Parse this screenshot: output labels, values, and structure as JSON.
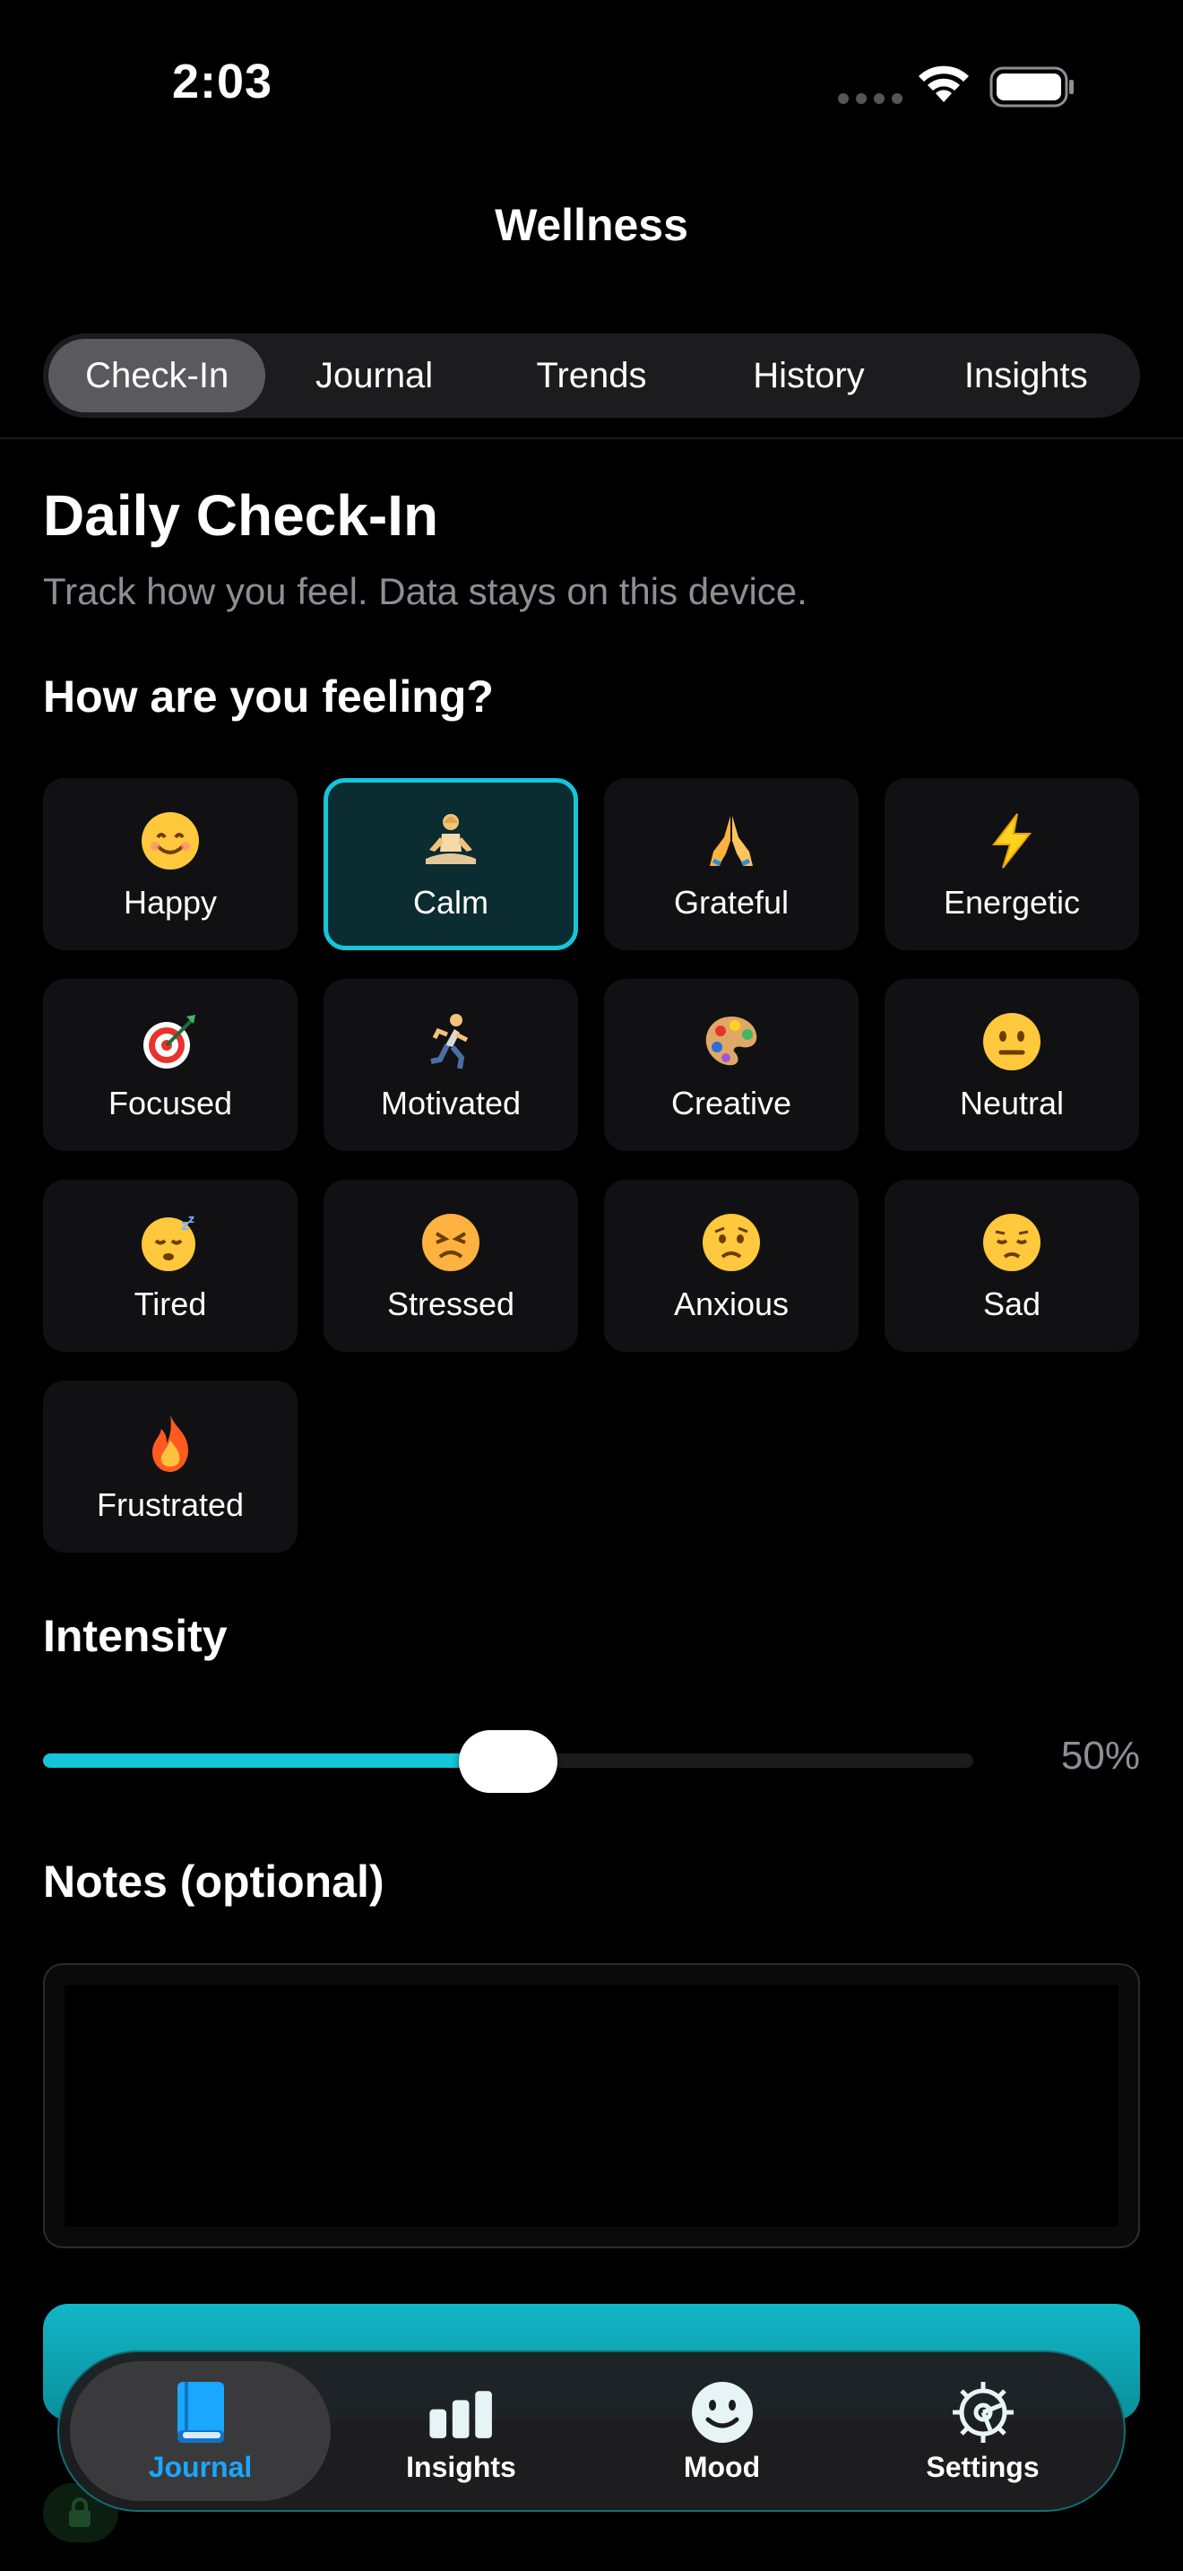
{
  "status": {
    "time": "2:03"
  },
  "nav": {
    "title": "Wellness"
  },
  "segments": [
    {
      "label": "Check-In",
      "active": true
    },
    {
      "label": "Journal",
      "active": false
    },
    {
      "label": "Trends",
      "active": false
    },
    {
      "label": "History",
      "active": false
    },
    {
      "label": "Insights",
      "active": false
    }
  ],
  "checkin": {
    "title": "Daily Check-In",
    "subtitle": "Track how you feel. Data stays on this device.",
    "feeling_heading": "How are you feeling?",
    "moods": [
      {
        "label": "Happy",
        "icon": "smiling-face-icon"
      },
      {
        "label": "Calm",
        "icon": "meditation-icon",
        "selected": true
      },
      {
        "label": "Grateful",
        "icon": "folded-hands-icon"
      },
      {
        "label": "Energetic",
        "icon": "lightning-icon"
      },
      {
        "label": "Focused",
        "icon": "target-icon"
      },
      {
        "label": "Motivated",
        "icon": "runner-icon"
      },
      {
        "label": "Creative",
        "icon": "palette-icon"
      },
      {
        "label": "Neutral",
        "icon": "neutral-face-icon"
      },
      {
        "label": "Tired",
        "icon": "sleepy-face-icon"
      },
      {
        "label": "Stressed",
        "icon": "stressed-face-icon"
      },
      {
        "label": "Anxious",
        "icon": "worried-face-icon"
      },
      {
        "label": "Sad",
        "icon": "sad-face-icon"
      },
      {
        "label": "Frustrated",
        "icon": "fire-icon"
      }
    ],
    "intensity_heading": "Intensity",
    "intensity_value": 0.5,
    "intensity_label": "50%",
    "notes_heading": "Notes (optional)",
    "notes_value": ""
  },
  "colors": {
    "accent": "#14c6d9",
    "tab_active": "#1aa7ff",
    "background": "#000000"
  },
  "tabbar": {
    "items": [
      {
        "label": "Journal",
        "icon": "book-icon",
        "active": true
      },
      {
        "label": "Insights",
        "icon": "bar-chart-icon",
        "active": false
      },
      {
        "label": "Mood",
        "icon": "smiley-icon",
        "active": false
      },
      {
        "label": "Settings",
        "icon": "gear-icon",
        "active": false
      }
    ]
  }
}
